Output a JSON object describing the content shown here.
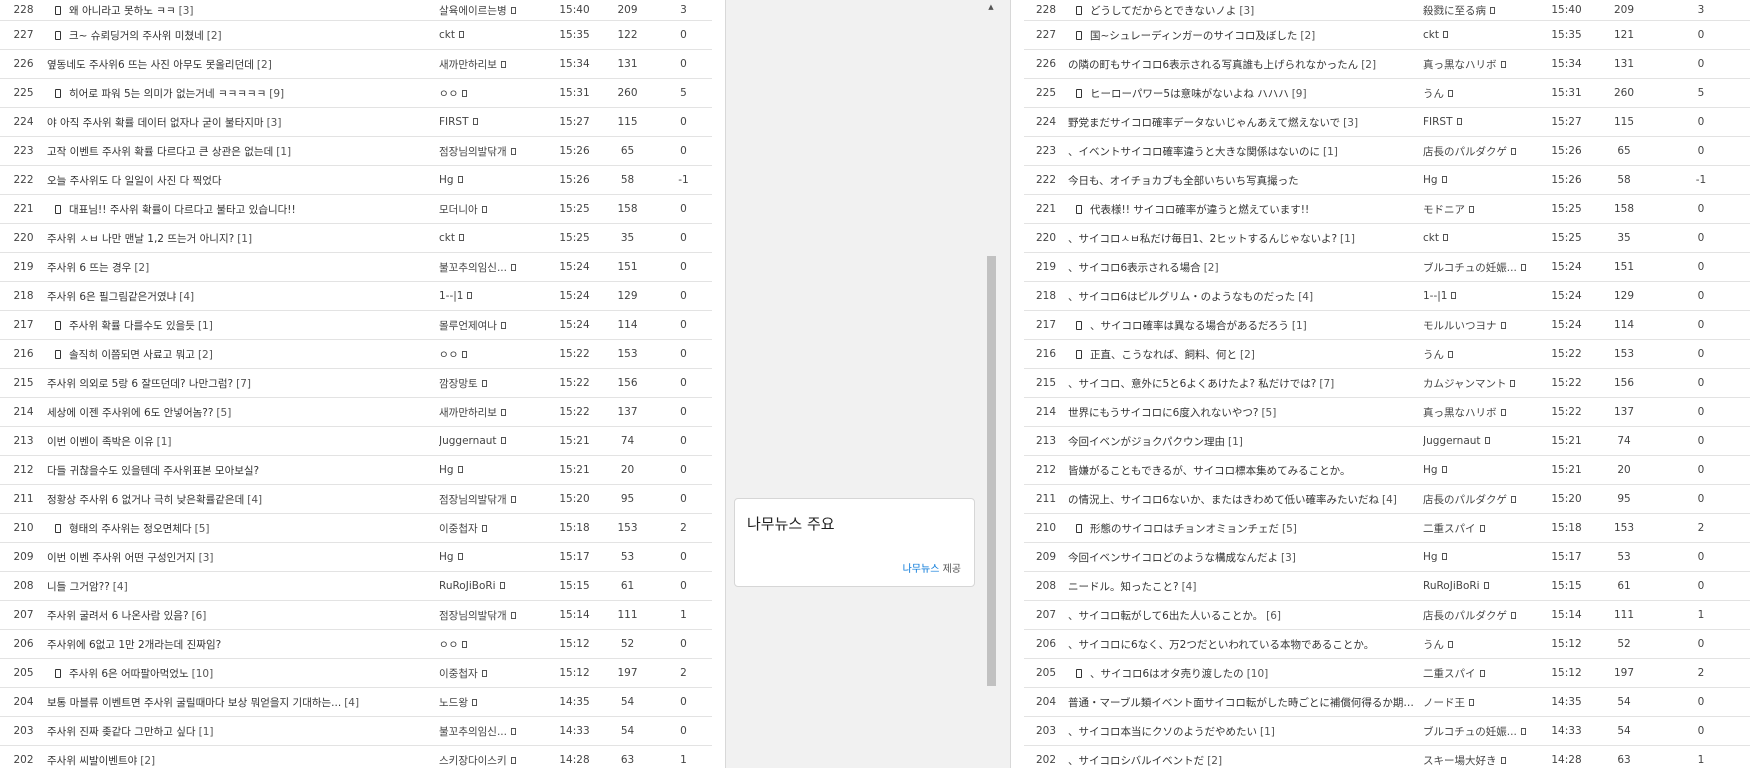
{
  "left_posts": [
    {
      "num": "228",
      "has_image": true,
      "title": "왜 아니라고 못하노 ㅋㅋ",
      "comments": "[3]",
      "author": "살육에이르는병",
      "time": "15:40",
      "views": "209",
      "votes": "3"
    },
    {
      "num": "227",
      "has_image": true,
      "title": "크~ 슈뢰딩거의 주사위 미쳤네",
      "comments": "[2]",
      "author": "ckt",
      "time": "15:35",
      "views": "122",
      "votes": "0"
    },
    {
      "num": "226",
      "has_image": false,
      "title": "옆동네도 주사위6 뜨는 사진 아무도 못올리던데",
      "comments": "[2]",
      "author": "새까만하리보",
      "time": "15:34",
      "views": "131",
      "votes": "0"
    },
    {
      "num": "225",
      "has_image": true,
      "title": "히어로 파워 5는 의미가 없는거네 ㅋㅋㅋㅋㅋ",
      "comments": "[9]",
      "author": "ㅇㅇ",
      "time": "15:31",
      "views": "260",
      "votes": "5"
    },
    {
      "num": "224",
      "has_image": false,
      "title": "야 아직 주사위 확률 데이터 없자나 굳이 불타지마",
      "comments": "[3]",
      "author": "FIRST",
      "time": "15:27",
      "views": "115",
      "votes": "0"
    },
    {
      "num": "223",
      "has_image": false,
      "title": "고작 이벤트 주사위 확률 다르다고 큰 상관은 없는데",
      "comments": "[1]",
      "author": "점장님의발닦개",
      "time": "15:26",
      "views": "65",
      "votes": "0"
    },
    {
      "num": "222",
      "has_image": false,
      "title": "오늘 주사위도 다 일일이 사진 다 찍었다",
      "comments": "",
      "author": "Hg",
      "time": "15:26",
      "views": "58",
      "votes": "-1"
    },
    {
      "num": "221",
      "has_image": true,
      "title": "대표님!! 주사위 확률이 다르다고 불타고 있습니다!!",
      "comments": "",
      "author": "모더니아",
      "time": "15:25",
      "views": "158",
      "votes": "0"
    },
    {
      "num": "220",
      "has_image": false,
      "title": "주사위 ㅅㅂ 나만 맨날 1,2 뜨는거 아니지?",
      "comments": "[1]",
      "author": "ckt",
      "time": "15:25",
      "views": "35",
      "votes": "0"
    },
    {
      "num": "219",
      "has_image": false,
      "title": "주사위 6 뜨는 경우",
      "comments": "[2]",
      "author": "불꼬추의임신...",
      "time": "15:24",
      "views": "151",
      "votes": "0"
    },
    {
      "num": "218",
      "has_image": false,
      "title": "주사위 6은 필그림같은거였냐",
      "comments": "[4]",
      "author": "1--|1",
      "time": "15:24",
      "views": "129",
      "votes": "0"
    },
    {
      "num": "217",
      "has_image": true,
      "title": "주사위 확률 다를수도 있을듯",
      "comments": "[1]",
      "author": "몰루언제여나",
      "time": "15:24",
      "views": "114",
      "votes": "0"
    },
    {
      "num": "216",
      "has_image": true,
      "title": "솔직히 이쯤되면 사료고 뭐고",
      "comments": "[2]",
      "author": "ㅇㅇ",
      "time": "15:22",
      "views": "153",
      "votes": "0"
    },
    {
      "num": "215",
      "has_image": false,
      "title": "주사위 의외로 5랑 6 잘뜨던데? 나만그럼?",
      "comments": "[7]",
      "author": "깜장망토",
      "time": "15:22",
      "views": "156",
      "votes": "0"
    },
    {
      "num": "214",
      "has_image": false,
      "title": "세상에 이젠 주사위에 6도 안넣어놈??",
      "comments": "[5]",
      "author": "새까만하리보",
      "time": "15:22",
      "views": "137",
      "votes": "0"
    },
    {
      "num": "213",
      "has_image": false,
      "title": "이번 이벤이 족박은 이유",
      "comments": "[1]",
      "author": "Juggernaut",
      "time": "15:21",
      "views": "74",
      "votes": "0"
    },
    {
      "num": "212",
      "has_image": false,
      "title": "다들 귀찮을수도 있을텐데 주사위표본 모아보실?",
      "comments": "",
      "author": "Hg",
      "time": "15:21",
      "views": "20",
      "votes": "0"
    },
    {
      "num": "211",
      "has_image": false,
      "title": "정황상 주사위 6 없거나 극히 낮은확률같은데",
      "comments": "[4]",
      "author": "점장님의발닦개",
      "time": "15:20",
      "views": "95",
      "votes": "0"
    },
    {
      "num": "210",
      "has_image": true,
      "title": "형태의 주사위는 정오면체다",
      "comments": "[5]",
      "author": "이중첩자",
      "time": "15:18",
      "views": "153",
      "votes": "2"
    },
    {
      "num": "209",
      "has_image": false,
      "title": "이번 이벤 주사위 어떤 구성인거지",
      "comments": "[3]",
      "author": "Hg",
      "time": "15:17",
      "views": "53",
      "votes": "0"
    },
    {
      "num": "208",
      "has_image": false,
      "title": "니들 그거암??",
      "comments": "[4]",
      "author": "RuRoJiBoRi",
      "time": "15:15",
      "views": "61",
      "votes": "0"
    },
    {
      "num": "207",
      "has_image": false,
      "title": "주사위 굴려서 6 나온사람 있음?",
      "comments": "[6]",
      "author": "점장님의발닦개",
      "time": "15:14",
      "views": "111",
      "votes": "1"
    },
    {
      "num": "206",
      "has_image": false,
      "title": "주사위에 6없고 1만 2개라는데 진짜임?",
      "comments": "",
      "author": "ㅇㅇ",
      "time": "15:12",
      "views": "52",
      "votes": "0"
    },
    {
      "num": "205",
      "has_image": true,
      "title": "주사위 6은 어따팔아먹었노",
      "comments": "[10]",
      "author": "이중첩자",
      "time": "15:12",
      "views": "197",
      "votes": "2"
    },
    {
      "num": "204",
      "has_image": false,
      "title": "보통 마블류 이벤트면 주사위 굴릴때마다 보상 뭐얻을지 기대하는...",
      "comments": "[4]",
      "author": "노드왕",
      "time": "14:35",
      "views": "54",
      "votes": "0"
    },
    {
      "num": "203",
      "has_image": false,
      "title": "주사위 진짜 좆같다 그만하고 싶다",
      "comments": "[1]",
      "author": "불꼬추의임신...",
      "time": "14:33",
      "views": "54",
      "votes": "0"
    },
    {
      "num": "202",
      "has_image": false,
      "title": "주사위 씨발이벤트야",
      "comments": "[2]",
      "author": "스키장다이스키",
      "time": "14:28",
      "views": "63",
      "votes": "1"
    }
  ],
  "right_posts": [
    {
      "num": "228",
      "has_image": true,
      "title": "どうしてだからとできないノよ",
      "comments": "[3]",
      "author": "殺戮に至る病",
      "time": "15:40",
      "views": "209",
      "votes": "3"
    },
    {
      "num": "227",
      "has_image": true,
      "title": "国~シュレーディンガーのサイコロ及ぼした",
      "comments": "[2]",
      "author": "ckt",
      "time": "15:35",
      "views": "121",
      "votes": "0"
    },
    {
      "num": "226",
      "has_image": false,
      "title": "の隣の町もサイコロ6表示される写真誰も上げられなかったん",
      "comments": "[2]",
      "author": "真っ黒なハリボ",
      "time": "15:34",
      "views": "131",
      "votes": "0"
    },
    {
      "num": "225",
      "has_image": true,
      "title": "ヒーローパワー5は意味がないよね ハハハ",
      "comments": "[9]",
      "author": "うん",
      "time": "15:31",
      "views": "260",
      "votes": "5"
    },
    {
      "num": "224",
      "has_image": false,
      "title": "野党まだサイコロ確率データないじゃんあえて燃えないで",
      "comments": "[3]",
      "author": "FIRST",
      "time": "15:27",
      "views": "115",
      "votes": "0"
    },
    {
      "num": "223",
      "has_image": false,
      "title": "、イベントサイコロ確率違うと大きな関係はないのに",
      "comments": "[1]",
      "author": "店長のパルダクゲ",
      "time": "15:26",
      "views": "65",
      "votes": "0"
    },
    {
      "num": "222",
      "has_image": false,
      "title": "今日も、オイチョカブも全部いちいち写真撮った",
      "comments": "",
      "author": "Hg",
      "time": "15:26",
      "views": "58",
      "votes": "-1"
    },
    {
      "num": "221",
      "has_image": true,
      "title": "代表様!! サイコロ確率が違うと燃えています!!",
      "comments": "",
      "author": "モドニア",
      "time": "15:25",
      "views": "158",
      "votes": "0"
    },
    {
      "num": "220",
      "has_image": false,
      "title": "、サイコロㅅㅂ私だけ毎日1、2ヒットするんじゃないよ?",
      "comments": "[1]",
      "author": "ckt",
      "time": "15:25",
      "views": "35",
      "votes": "0"
    },
    {
      "num": "219",
      "has_image": false,
      "title": "、サイコロ6表示される場合",
      "comments": "[2]",
      "author": "ブルコチュの妊娠...",
      "time": "15:24",
      "views": "151",
      "votes": "0"
    },
    {
      "num": "218",
      "has_image": false,
      "title": "、サイコロ6はピルグリム・のようなものだった",
      "comments": "[4]",
      "author": "1--|1",
      "time": "15:24",
      "views": "129",
      "votes": "0"
    },
    {
      "num": "217",
      "has_image": true,
      "title": "、サイコロ確率は異なる場合があるだろう",
      "comments": "[1]",
      "author": "モルルいつヨナ",
      "time": "15:24",
      "views": "114",
      "votes": "0"
    },
    {
      "num": "216",
      "has_image": true,
      "title": "正直、こうなれば、飼料、何と",
      "comments": "[2]",
      "author": "うん",
      "time": "15:22",
      "views": "153",
      "votes": "0"
    },
    {
      "num": "215",
      "has_image": false,
      "title": "、サイコロ、意外に5と6よくあけたよ? 私だけでは?",
      "comments": "[7]",
      "author": "カムジャンマント",
      "time": "15:22",
      "views": "156",
      "votes": "0"
    },
    {
      "num": "214",
      "has_image": false,
      "title": "世界にもうサイコロに6度入れないやつ?",
      "comments": "[5]",
      "author": "真っ黒なハリボ",
      "time": "15:22",
      "views": "137",
      "votes": "0"
    },
    {
      "num": "213",
      "has_image": false,
      "title": "今回イベンがジョクパクウン理由",
      "comments": "[1]",
      "author": "Juggernaut",
      "time": "15:21",
      "views": "74",
      "votes": "0"
    },
    {
      "num": "212",
      "has_image": false,
      "title": "皆嫌がることもできるが、サイコロ標本集めてみることか。",
      "comments": "",
      "author": "Hg",
      "time": "15:21",
      "views": "20",
      "votes": "0"
    },
    {
      "num": "211",
      "has_image": false,
      "title": "の情況上、サイコロ6ないか、またはきわめて低い確率みたいだね",
      "comments": "[4]",
      "author": "店長のパルダクゲ",
      "time": "15:20",
      "views": "95",
      "votes": "0"
    },
    {
      "num": "210",
      "has_image": true,
      "title": "形態のサイコロはチョンオミョンチェだ",
      "comments": "[5]",
      "author": "二重スパイ",
      "time": "15:18",
      "views": "153",
      "votes": "2"
    },
    {
      "num": "209",
      "has_image": false,
      "title": "今回イベンサイコロどのような構成なんだよ",
      "comments": "[3]",
      "author": "Hg",
      "time": "15:17",
      "views": "53",
      "votes": "0"
    },
    {
      "num": "208",
      "has_image": false,
      "title": "ニードル。知ったこと?",
      "comments": "[4]",
      "author": "RuRoJiBoRi",
      "time": "15:15",
      "views": "61",
      "votes": "0"
    },
    {
      "num": "207",
      "has_image": false,
      "title": "、サイコロ転がして6出た人いることか。",
      "comments": "[6]",
      "author": "店長のパルダクゲ",
      "time": "15:14",
      "views": "111",
      "votes": "1"
    },
    {
      "num": "206",
      "has_image": false,
      "title": "、サイコロに6なく、万2つだといわれている本物であることか。",
      "comments": "",
      "author": "うん",
      "time": "15:12",
      "views": "52",
      "votes": "0"
    },
    {
      "num": "205",
      "has_image": true,
      "title": "、サイコロ6はオタ売り渡したの",
      "comments": "[10]",
      "author": "二重スパイ",
      "time": "15:12",
      "views": "197",
      "votes": "2"
    },
    {
      "num": "204",
      "has_image": false,
      "title": "普通・マーブル類イベント面サイコロ転がした時ごとに補償何得るか期待...",
      "comments": "[4]",
      "author": "ノード王",
      "time": "14:35",
      "views": "54",
      "votes": "0"
    },
    {
      "num": "203",
      "has_image": false,
      "title": "、サイコロ本当にクソのようだやめたい",
      "comments": "[1]",
      "author": "ブルコチュの妊娠...",
      "time": "14:33",
      "views": "54",
      "votes": "0"
    },
    {
      "num": "202",
      "has_image": false,
      "title": "、サイコロシバルイベントだ",
      "comments": "[2]",
      "author": "スキー場大好き",
      "time": "14:28",
      "views": "63",
      "votes": "1"
    }
  ],
  "news": {
    "title": "나무뉴스 주요",
    "credit_link": "나무뉴스",
    "credit_suffix": "제공"
  },
  "scrollbar": {
    "up_arrow": "▲",
    "thumb_position": 0.37,
    "thumb_size": 0.62
  }
}
